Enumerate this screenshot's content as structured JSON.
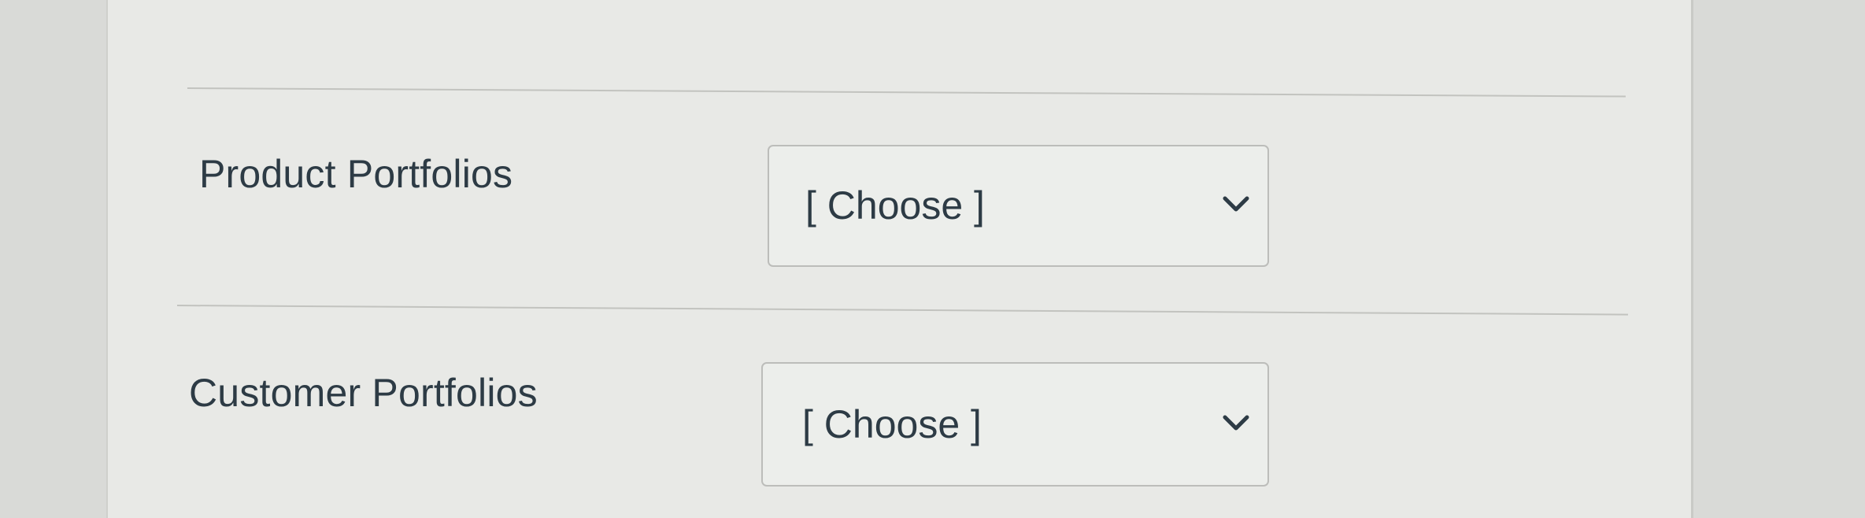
{
  "form": {
    "rows": [
      {
        "label": "Product Portfolios",
        "select_value": "[ Choose ]"
      },
      {
        "label": "Customer Portfolios",
        "select_value": "[ Choose ]"
      }
    ]
  },
  "icons": {
    "dropdown": "chevron-down-icon"
  },
  "colors": {
    "text": "#2d3b45",
    "panel_background": "#e8e9e6",
    "page_background": "#d9dad7",
    "select_border": "#bcbdba"
  }
}
